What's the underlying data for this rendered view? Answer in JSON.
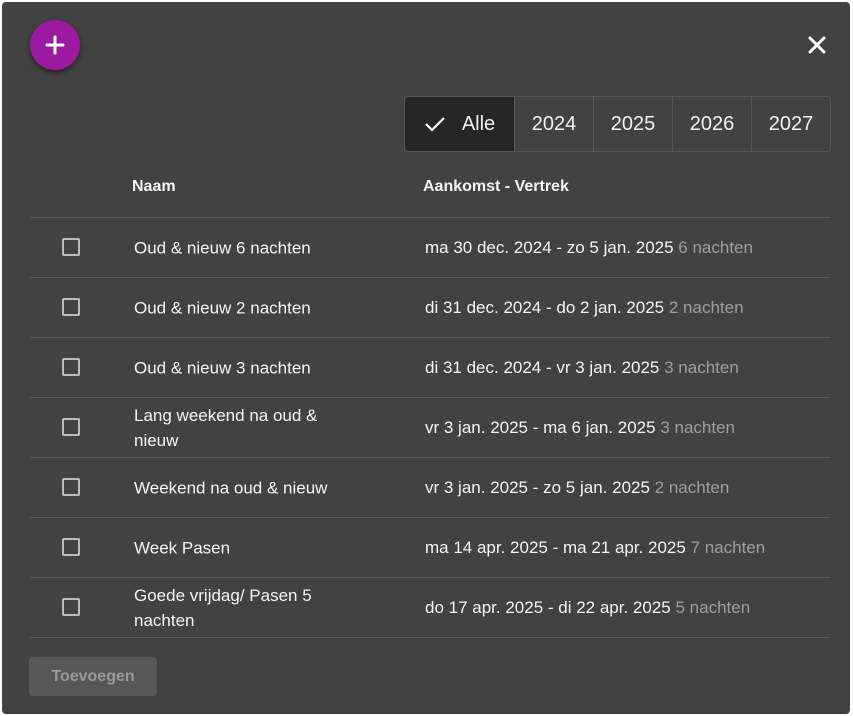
{
  "toolbar": {
    "add_icon": "plus-icon",
    "close_icon": "close-icon"
  },
  "year_filter": [
    {
      "label": "Alle",
      "selected": true
    },
    {
      "label": "2024",
      "selected": false
    },
    {
      "label": "2025",
      "selected": false
    },
    {
      "label": "2026",
      "selected": false
    },
    {
      "label": "2027",
      "selected": false
    }
  ],
  "table": {
    "headers": {
      "name": "Naam",
      "dates": "Aankomst - Vertrek"
    },
    "rows": [
      {
        "name": "Oud & nieuw 6 nachten",
        "dates": "ma 30 dec. 2024 - zo 5 jan. 2025",
        "nights": "6 nachten"
      },
      {
        "name": "Oud & nieuw 2 nachten",
        "dates": "di 31 dec. 2024 - do 2 jan. 2025",
        "nights": "2 nachten"
      },
      {
        "name": "Oud & nieuw 3 nachten",
        "dates": "di 31 dec. 2024 - vr 3 jan. 2025",
        "nights": "3 nachten"
      },
      {
        "name": "Lang weekend na oud & nieuw",
        "dates": "vr 3 jan. 2025 - ma 6 jan. 2025",
        "nights": "3 nachten"
      },
      {
        "name": "Weekend na oud & nieuw",
        "dates": "vr 3 jan. 2025 - zo 5 jan. 2025",
        "nights": "2 nachten"
      },
      {
        "name": "Week Pasen",
        "dates": "ma 14 apr. 2025 - ma 21 apr. 2025",
        "nights": "7 nachten"
      },
      {
        "name": "Goede vrijdag/ Pasen 5 nachten",
        "dates": "do 17 apr. 2025 - di 22 apr. 2025",
        "nights": "5 nachten"
      }
    ]
  },
  "footer": {
    "add_label": "Toevoegen"
  },
  "colors": {
    "accent": "#9c1aa0",
    "background": "#424242",
    "selected_toggle": "#262626"
  }
}
